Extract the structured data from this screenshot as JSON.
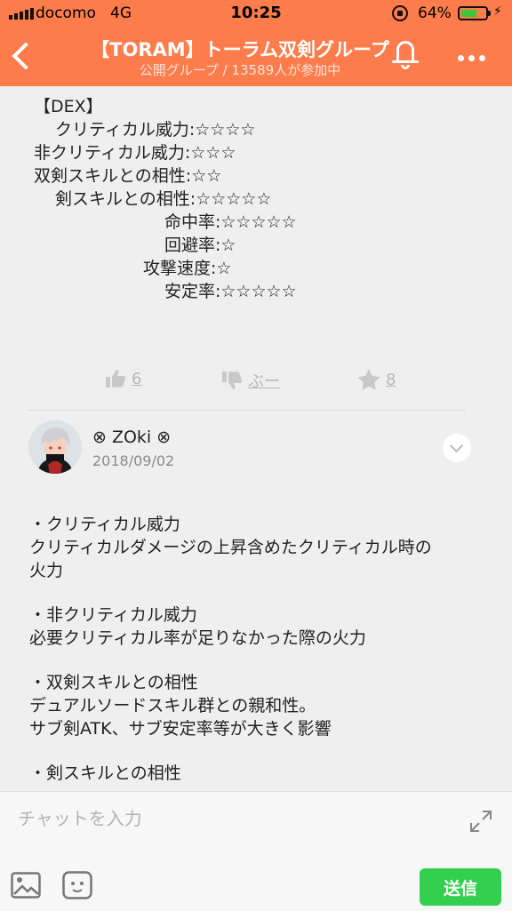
{
  "status_bar": {
    "carrier": "docomo",
    "network": "4G",
    "time": "10:25",
    "battery_percent": "64%",
    "battery_level": 0.64
  },
  "header": {
    "title": "【TORAM】トーラム双剣グループ",
    "subtitle": "公開グループ / 13589人が参加中"
  },
  "post": {
    "lines": [
      "【DEX】",
      "クリティカル威力:☆☆☆☆",
      "非クリティカル威力:☆☆☆",
      "双剣スキルとの相性:☆☆",
      "剣スキルとの相性:☆☆☆☆☆",
      "命中率:☆☆☆☆☆",
      "回避率:☆",
      "攻撃速度:☆",
      "安定率:☆☆☆☆☆"
    ],
    "like_count": "6",
    "dislike_label": "ぶー",
    "favorite_count": "8"
  },
  "comment": {
    "author": "⊗ ZOki ⊗",
    "date": "2018/09/02",
    "paragraphs": [
      [
        "・クリティカル威力",
        "クリティカルダメージの上昇含めたクリティカル時の",
        "火力"
      ],
      [
        "・非クリティカル威力",
        "必要クリティカル率が足りなかった際の火力"
      ],
      [
        "・双剣スキルとの相性",
        "デュアルソードスキル群との親和性。",
        "サブ剣ATK、サブ安定率等が大きく影響"
      ],
      [
        "・剣スキルとの相性"
      ]
    ]
  },
  "composer": {
    "placeholder": "チャットを入力",
    "send_label": "送信"
  },
  "colors": {
    "header": "#fc7c4c",
    "send": "#33cf4f"
  }
}
